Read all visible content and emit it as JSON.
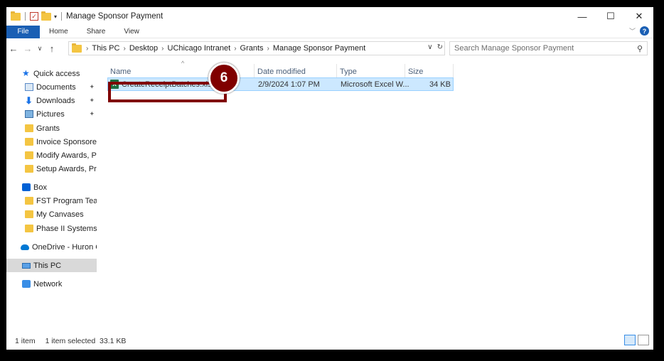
{
  "window": {
    "title": "Manage Sponsor Payment",
    "controls": {
      "minimize": "—",
      "maximize": "☐",
      "close": "✕"
    }
  },
  "ribbon": {
    "tabs": [
      "File",
      "Home",
      "Share",
      "View"
    ],
    "help": "?"
  },
  "address": {
    "crumbs": [
      "This PC",
      "Desktop",
      "UChicago Intranet",
      "Grants",
      "Manage Sponsor Payment"
    ],
    "search_placeholder": "Search Manage Sponsor Payment"
  },
  "nav_pane": {
    "items": [
      {
        "label": "Quick access",
        "icon": "star-icon"
      },
      {
        "label": "Documents",
        "icon": "documents-icon",
        "pinned": true
      },
      {
        "label": "Downloads",
        "icon": "download-icon",
        "pinned": true
      },
      {
        "label": "Pictures",
        "icon": "pictures-icon",
        "pinned": true
      },
      {
        "label": "Grants",
        "icon": "folder-icon"
      },
      {
        "label": "Invoice Sponsored A",
        "icon": "folder-icon"
      },
      {
        "label": "Modify Awards, Proj",
        "icon": "folder-icon"
      },
      {
        "label": "Setup Awards, Proje",
        "icon": "folder-icon"
      },
      {
        "label": "Box",
        "icon": "box-icon"
      },
      {
        "label": "FST Program Team",
        "icon": "folder-icon"
      },
      {
        "label": "My Canvases",
        "icon": "folder-icon"
      },
      {
        "label": "Phase II Systems Inv",
        "icon": "folder-icon"
      },
      {
        "label": "OneDrive - Huron Co",
        "icon": "onedrive-icon"
      },
      {
        "label": "This PC",
        "icon": "this-pc-icon",
        "selected": true
      },
      {
        "label": "Network",
        "icon": "network-icon"
      }
    ]
  },
  "file_list": {
    "columns": [
      "Name",
      "Date modified",
      "Type",
      "Size"
    ],
    "rows": [
      {
        "name": "CreateReceiptBatches.xlsx",
        "date": "2/9/2024 1:07 PM",
        "type": "Microsoft Excel W...",
        "size": "34 KB",
        "selected": true
      }
    ]
  },
  "callout": {
    "number": "6",
    "color": "#800000"
  },
  "status": {
    "count": "1 item",
    "selection": "1 item selected  33.1 KB"
  },
  "colors": {
    "accent": "#1a5fb4",
    "selection": "#cce8ff",
    "callout": "#800000"
  }
}
